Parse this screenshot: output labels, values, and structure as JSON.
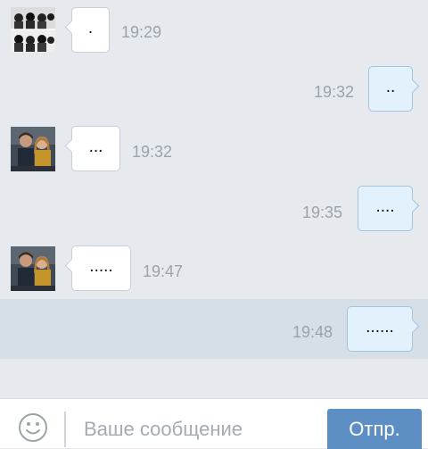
{
  "messages": [
    {
      "text": ".",
      "time": "19:29",
      "incoming": true,
      "avatar": "avatar-collage"
    },
    {
      "text": "..",
      "time": "19:32",
      "incoming": false
    },
    {
      "text": "...",
      "time": "19:32",
      "incoming": true,
      "avatar": "avatar-couple-photo"
    },
    {
      "text": "....",
      "time": "19:35",
      "incoming": false
    },
    {
      "text": ".....",
      "time": "19:47",
      "incoming": true,
      "avatar": "avatar-couple-photo"
    },
    {
      "text": "......",
      "time": "19:48",
      "incoming": false,
      "selected": true
    }
  ],
  "composer": {
    "placeholder": "Ваше сообщение",
    "send_label": "Отпр.",
    "emoji_icon": "smiley-icon"
  },
  "colors": {
    "background": "#e6eaee",
    "selected_row": "#d6dee7",
    "incoming_bubble": "#ffffff",
    "outgoing_bubble": "#e2f1fc",
    "send_button": "#5d8fc4",
    "timestamp": "#9aa3ad"
  }
}
